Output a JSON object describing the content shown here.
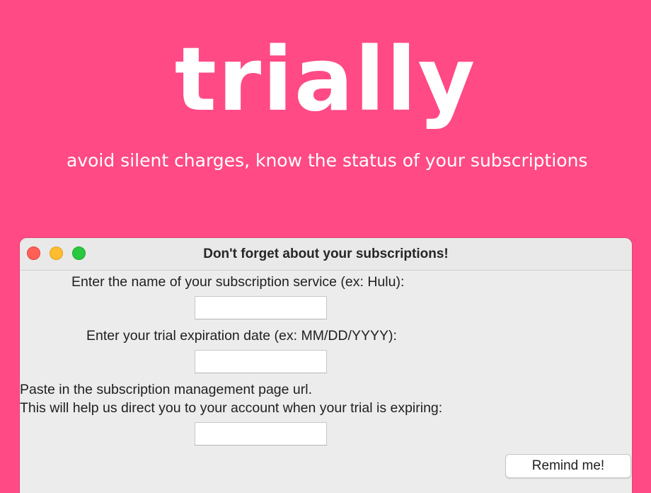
{
  "hero": {
    "title": "trially",
    "tagline": "avoid silent charges, know the status of your subscriptions"
  },
  "window": {
    "title": "Don't forget about your subscriptions!"
  },
  "form": {
    "service_label": "Enter the name of your subscription service (ex: Hulu):",
    "service_value": "",
    "date_label": "Enter your trial expiration date (ex: MM/DD/YYYY):",
    "date_value": "",
    "url_label_line1": "Paste in the subscription management page url.",
    "url_label_line2": "This will help us direct you to your account when your trial is expiring:",
    "url_value": "",
    "submit_label": "Remind me!"
  },
  "colors": {
    "background": "#ff4a85",
    "close": "#fe5f57",
    "minimize": "#febc2e",
    "zoom": "#28c840"
  }
}
